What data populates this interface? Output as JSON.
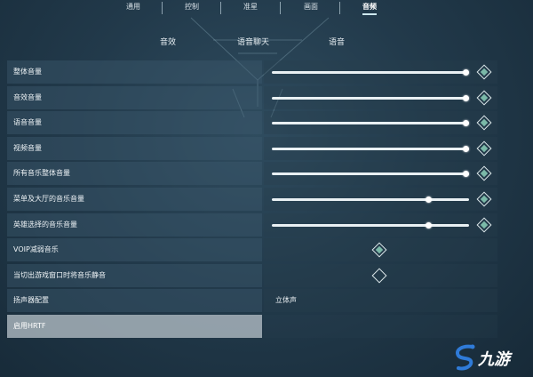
{
  "top_tabs": [
    "通用",
    "控制",
    "准星",
    "画面",
    "音频"
  ],
  "sub_tabs": [
    "音效",
    "语音聊天",
    "语音"
  ],
  "settings": {
    "master_volume": {
      "label": "整体音量",
      "level": 1.0
    },
    "sfx_volume": {
      "label": "音效音量",
      "level": 1.0
    },
    "voice_volume": {
      "label": "语音音量",
      "level": 1.0
    },
    "video_volume": {
      "label": "视频音量",
      "level": 1.0
    },
    "music_master_volume": {
      "label": "所有音乐整体音量",
      "level": 1.0
    },
    "menu_lobby_music_volume": {
      "label": "菜单及大厅的音乐音量",
      "level": 0.8
    },
    "agent_select_music_volume": {
      "label": "英雄选择的音乐音量",
      "level": 0.8
    },
    "voip_ducks_music": {
      "label": "VOIP减弱音乐",
      "checked": true
    },
    "mute_music_unfocused": {
      "label": "当切出游戏窗口时将音乐静音",
      "checked": false
    },
    "speaker_config": {
      "label": "扬声器配置",
      "value": "立体声"
    },
    "enable_hrtf": {
      "label": "启用HRTF"
    }
  },
  "watermark": {
    "logo_text": "九游",
    "accent_color": "#2f7bd8"
  }
}
